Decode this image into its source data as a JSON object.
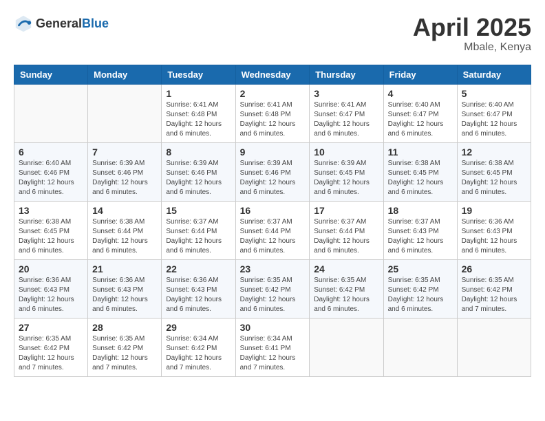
{
  "header": {
    "logo": {
      "general": "General",
      "blue": "Blue"
    },
    "title": "April 2025",
    "location": "Mbale, Kenya"
  },
  "weekdays": [
    "Sunday",
    "Monday",
    "Tuesday",
    "Wednesday",
    "Thursday",
    "Friday",
    "Saturday"
  ],
  "weeks": [
    [
      {
        "day": "",
        "info": ""
      },
      {
        "day": "",
        "info": ""
      },
      {
        "day": "1",
        "info": "Sunrise: 6:41 AM\nSunset: 6:48 PM\nDaylight: 12 hours and 6 minutes."
      },
      {
        "day": "2",
        "info": "Sunrise: 6:41 AM\nSunset: 6:48 PM\nDaylight: 12 hours and 6 minutes."
      },
      {
        "day": "3",
        "info": "Sunrise: 6:41 AM\nSunset: 6:47 PM\nDaylight: 12 hours and 6 minutes."
      },
      {
        "day": "4",
        "info": "Sunrise: 6:40 AM\nSunset: 6:47 PM\nDaylight: 12 hours and 6 minutes."
      },
      {
        "day": "5",
        "info": "Sunrise: 6:40 AM\nSunset: 6:47 PM\nDaylight: 12 hours and 6 minutes."
      }
    ],
    [
      {
        "day": "6",
        "info": "Sunrise: 6:40 AM\nSunset: 6:46 PM\nDaylight: 12 hours and 6 minutes."
      },
      {
        "day": "7",
        "info": "Sunrise: 6:39 AM\nSunset: 6:46 PM\nDaylight: 12 hours and 6 minutes."
      },
      {
        "day": "8",
        "info": "Sunrise: 6:39 AM\nSunset: 6:46 PM\nDaylight: 12 hours and 6 minutes."
      },
      {
        "day": "9",
        "info": "Sunrise: 6:39 AM\nSunset: 6:46 PM\nDaylight: 12 hours and 6 minutes."
      },
      {
        "day": "10",
        "info": "Sunrise: 6:39 AM\nSunset: 6:45 PM\nDaylight: 12 hours and 6 minutes."
      },
      {
        "day": "11",
        "info": "Sunrise: 6:38 AM\nSunset: 6:45 PM\nDaylight: 12 hours and 6 minutes."
      },
      {
        "day": "12",
        "info": "Sunrise: 6:38 AM\nSunset: 6:45 PM\nDaylight: 12 hours and 6 minutes."
      }
    ],
    [
      {
        "day": "13",
        "info": "Sunrise: 6:38 AM\nSunset: 6:45 PM\nDaylight: 12 hours and 6 minutes."
      },
      {
        "day": "14",
        "info": "Sunrise: 6:38 AM\nSunset: 6:44 PM\nDaylight: 12 hours and 6 minutes."
      },
      {
        "day": "15",
        "info": "Sunrise: 6:37 AM\nSunset: 6:44 PM\nDaylight: 12 hours and 6 minutes."
      },
      {
        "day": "16",
        "info": "Sunrise: 6:37 AM\nSunset: 6:44 PM\nDaylight: 12 hours and 6 minutes."
      },
      {
        "day": "17",
        "info": "Sunrise: 6:37 AM\nSunset: 6:44 PM\nDaylight: 12 hours and 6 minutes."
      },
      {
        "day": "18",
        "info": "Sunrise: 6:37 AM\nSunset: 6:43 PM\nDaylight: 12 hours and 6 minutes."
      },
      {
        "day": "19",
        "info": "Sunrise: 6:36 AM\nSunset: 6:43 PM\nDaylight: 12 hours and 6 minutes."
      }
    ],
    [
      {
        "day": "20",
        "info": "Sunrise: 6:36 AM\nSunset: 6:43 PM\nDaylight: 12 hours and 6 minutes."
      },
      {
        "day": "21",
        "info": "Sunrise: 6:36 AM\nSunset: 6:43 PM\nDaylight: 12 hours and 6 minutes."
      },
      {
        "day": "22",
        "info": "Sunrise: 6:36 AM\nSunset: 6:43 PM\nDaylight: 12 hours and 6 minutes."
      },
      {
        "day": "23",
        "info": "Sunrise: 6:35 AM\nSunset: 6:42 PM\nDaylight: 12 hours and 6 minutes."
      },
      {
        "day": "24",
        "info": "Sunrise: 6:35 AM\nSunset: 6:42 PM\nDaylight: 12 hours and 6 minutes."
      },
      {
        "day": "25",
        "info": "Sunrise: 6:35 AM\nSunset: 6:42 PM\nDaylight: 12 hours and 6 minutes."
      },
      {
        "day": "26",
        "info": "Sunrise: 6:35 AM\nSunset: 6:42 PM\nDaylight: 12 hours and 7 minutes."
      }
    ],
    [
      {
        "day": "27",
        "info": "Sunrise: 6:35 AM\nSunset: 6:42 PM\nDaylight: 12 hours and 7 minutes."
      },
      {
        "day": "28",
        "info": "Sunrise: 6:35 AM\nSunset: 6:42 PM\nDaylight: 12 hours and 7 minutes."
      },
      {
        "day": "29",
        "info": "Sunrise: 6:34 AM\nSunset: 6:42 PM\nDaylight: 12 hours and 7 minutes."
      },
      {
        "day": "30",
        "info": "Sunrise: 6:34 AM\nSunset: 6:41 PM\nDaylight: 12 hours and 7 minutes."
      },
      {
        "day": "",
        "info": ""
      },
      {
        "day": "",
        "info": ""
      },
      {
        "day": "",
        "info": ""
      }
    ]
  ]
}
